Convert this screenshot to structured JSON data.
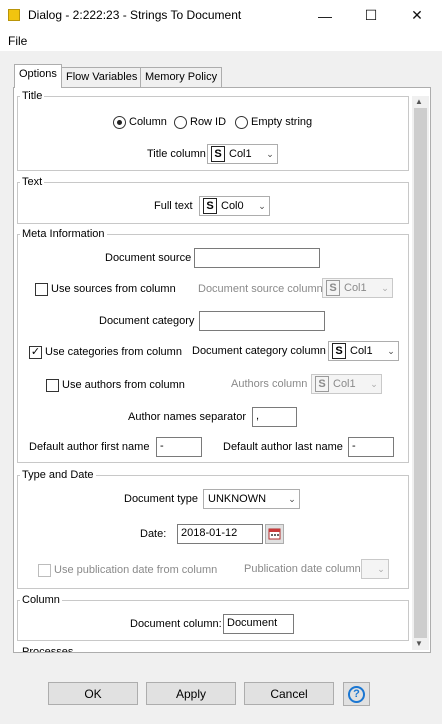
{
  "window": {
    "title": "Dialog - 2:222:23 - Strings To Document",
    "minimize_glyph": "—",
    "maximize_glyph": "☐",
    "close_glyph": "✕"
  },
  "menu": {
    "file": "File"
  },
  "tabs": [
    {
      "label": "Options",
      "active": true
    },
    {
      "label": "Flow Variables",
      "active": false
    },
    {
      "label": "Memory Policy",
      "active": false
    }
  ],
  "title_group": {
    "legend": "Title",
    "radio_column": "Column",
    "radio_rowid": "Row ID",
    "radio_empty": "Empty string",
    "selected": "Column",
    "title_column_label": "Title column",
    "title_column_value": "Col1"
  },
  "text_group": {
    "legend": "Text",
    "full_text_label": "Full text",
    "full_text_value": "Col0"
  },
  "meta_group": {
    "legend": "Meta Information",
    "document_source_label": "Document source",
    "document_source_value": "",
    "use_sources_label": "Use sources from column",
    "use_sources_checked": false,
    "document_source_column_label": "Document source column",
    "document_source_column_value": "Col1",
    "document_category_label": "Document category",
    "document_category_value": "",
    "use_categories_label": "Use categories from column",
    "use_categories_checked": true,
    "document_category_column_label": "Document category column",
    "document_category_column_value": "Col1",
    "use_authors_label": "Use authors from column",
    "use_authors_checked": false,
    "authors_column_label": "Authors column",
    "authors_column_value": "Col1",
    "author_separator_label": "Author names separator",
    "author_separator_value": ",",
    "default_first_label": "Default author first name",
    "default_first_value": "-",
    "default_last_label": "Default author last name",
    "default_last_value": "-"
  },
  "type_group": {
    "legend": "Type and Date",
    "document_type_label": "Document type",
    "document_type_value": "UNKNOWN",
    "date_label": "Date:",
    "date_value": "2018-01-12",
    "use_pub_date_label": "Use publication date from column",
    "pub_date_column_label": "Publication date column"
  },
  "column_group": {
    "legend": "Column",
    "document_column_label": "Document column:",
    "document_column_value": "Document"
  },
  "processes_group": {
    "legend": "Processes"
  },
  "buttons": {
    "ok": "OK",
    "apply": "Apply",
    "cancel": "Cancel",
    "help": "?"
  },
  "colors": {
    "accent": "#1b77d2",
    "titlebar_icon": "#f1c40f"
  }
}
